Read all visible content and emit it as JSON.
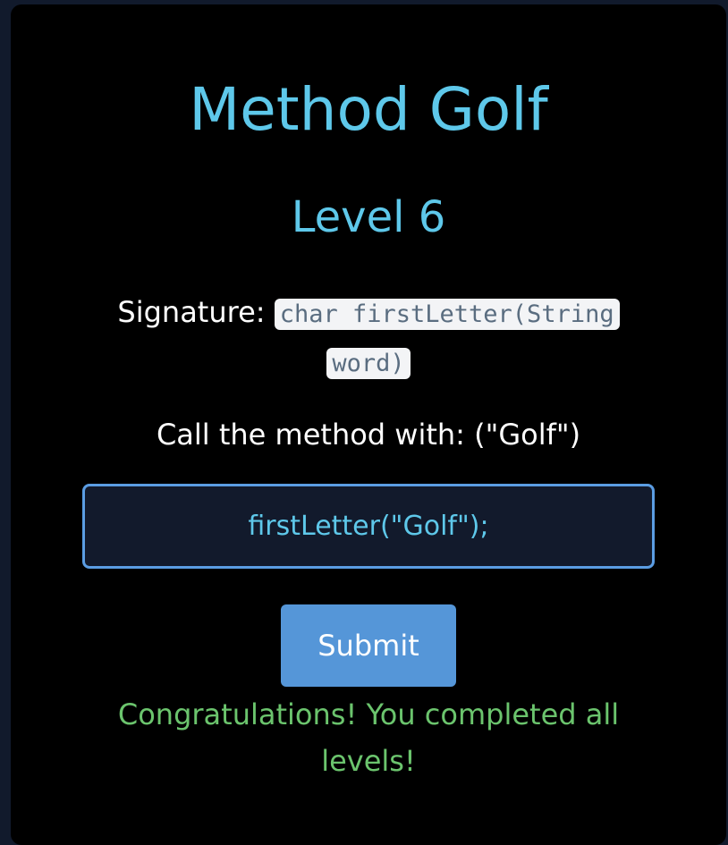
{
  "game": {
    "title": "Method Golf",
    "level": "Level 6",
    "signature_label": "Signature: ",
    "signature_code": "char firstLetter(String word)",
    "call_text": "Call the method with: (\"Golf\")",
    "answer_value": "firstLetter(\"Golf\");",
    "submit_label": "Submit",
    "message": "Congratulations! You completed all levels!"
  },
  "colors": {
    "accent": "#5ec8ea",
    "button": "#5596d8",
    "success": "#6bc46d",
    "input_border": "#5b9de3"
  }
}
